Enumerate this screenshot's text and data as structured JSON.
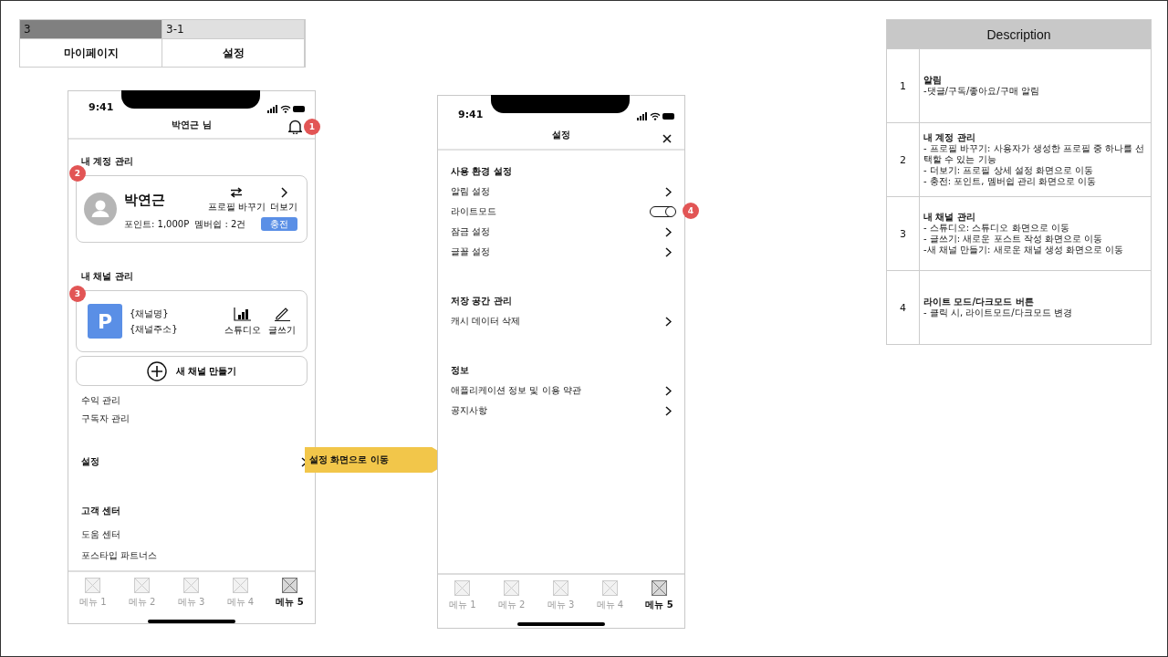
{
  "page_tabs": [
    {
      "number": "3",
      "title": "마이페이지",
      "selected": true
    },
    {
      "number": "3-1",
      "title": "설정",
      "selected": false
    }
  ],
  "mypage": {
    "time": "9:41",
    "title": "박연근 님",
    "bell_badge": "1",
    "account": {
      "heading": "내 계정 관리",
      "badge": "2",
      "name": "박연근",
      "points": "포인트: 1,000P",
      "membership": "멤버쉽 : 2건",
      "switch_label": "프로필 바꾸기",
      "more_label": "더보기",
      "charge": "충전"
    },
    "channel": {
      "heading": "내 채널 관리",
      "badge": "3",
      "logo": "P",
      "name": "{채널명}",
      "address": "{채널주소}",
      "studio": "스튜디오",
      "write": "글쓰기",
      "new_channel": "새 채널 만들기"
    },
    "links": [
      "수익 관리",
      "구독자 관리"
    ],
    "settings_row": "설정",
    "support": {
      "heading": "고객 센터",
      "items": [
        "도움 센터",
        "포스타입 파트너스"
      ]
    },
    "tab_bar": [
      {
        "label": "메뉴 1",
        "selected": false
      },
      {
        "label": "메뉴 2",
        "selected": false
      },
      {
        "label": "메뉴 3",
        "selected": false
      },
      {
        "label": "메뉴 4",
        "selected": false
      },
      {
        "label": "메뉴 5",
        "selected": true
      }
    ]
  },
  "arrow_note": "설정 화면으로 이동",
  "settings_screen": {
    "time": "9:41",
    "title": "설정",
    "toggle_badge": "4",
    "sections": [
      {
        "heading": "사용 환경 설정",
        "rows": [
          {
            "label": "알림 설정",
            "kind": "link"
          },
          {
            "label": "라이트모드",
            "kind": "toggle",
            "on": true
          },
          {
            "label": "잠금 설정",
            "kind": "link"
          },
          {
            "label": "글꼴 설정",
            "kind": "link"
          }
        ]
      },
      {
        "heading": "저장 공간 관리",
        "rows": [
          {
            "label": "캐시 데이터 삭제",
            "kind": "link"
          }
        ]
      },
      {
        "heading": "정보",
        "rows": [
          {
            "label": "애플리케이션 정보 및 이용 약관",
            "kind": "link"
          },
          {
            "label": "공지사항",
            "kind": "link"
          }
        ]
      }
    ],
    "tab_bar": [
      {
        "label": "메뉴 1",
        "selected": false
      },
      {
        "label": "메뉴 2",
        "selected": false
      },
      {
        "label": "메뉴 3",
        "selected": false
      },
      {
        "label": "메뉴 4",
        "selected": false
      },
      {
        "label": "메뉴 5",
        "selected": true
      }
    ]
  },
  "description": {
    "title": "Description",
    "rows": [
      {
        "number": "1",
        "title": "알림",
        "lines": [
          "-댓글/구독/좋아요/구매 알림"
        ]
      },
      {
        "number": "2",
        "title": "내 계정 관리",
        "lines": [
          "- 프로필 바꾸기: 사용자가 생성한 프로필 중 하나를 선택할 수 있는 기능",
          "- 더보기: 프로필 상세 설정 화면으로 이동",
          "- 충전: 포인트, 멤버쉽 관리 화면으로 이동"
        ]
      },
      {
        "number": "3",
        "title": "내 채널 관리",
        "lines": [
          "- 스튜디오: 스튜디오 화면으로 이동",
          "- 글쓰기: 새로운 포스트 작성 화면으로 이동",
          "-새 채널 만들기: 새로운 채널 생성 화면으로 이동"
        ]
      },
      {
        "number": "4",
        "title": "라이트 모드/다크모드 버튼",
        "lines": [
          "- 클릭 시, 라이트모드/다크모드 변경"
        ]
      }
    ]
  }
}
